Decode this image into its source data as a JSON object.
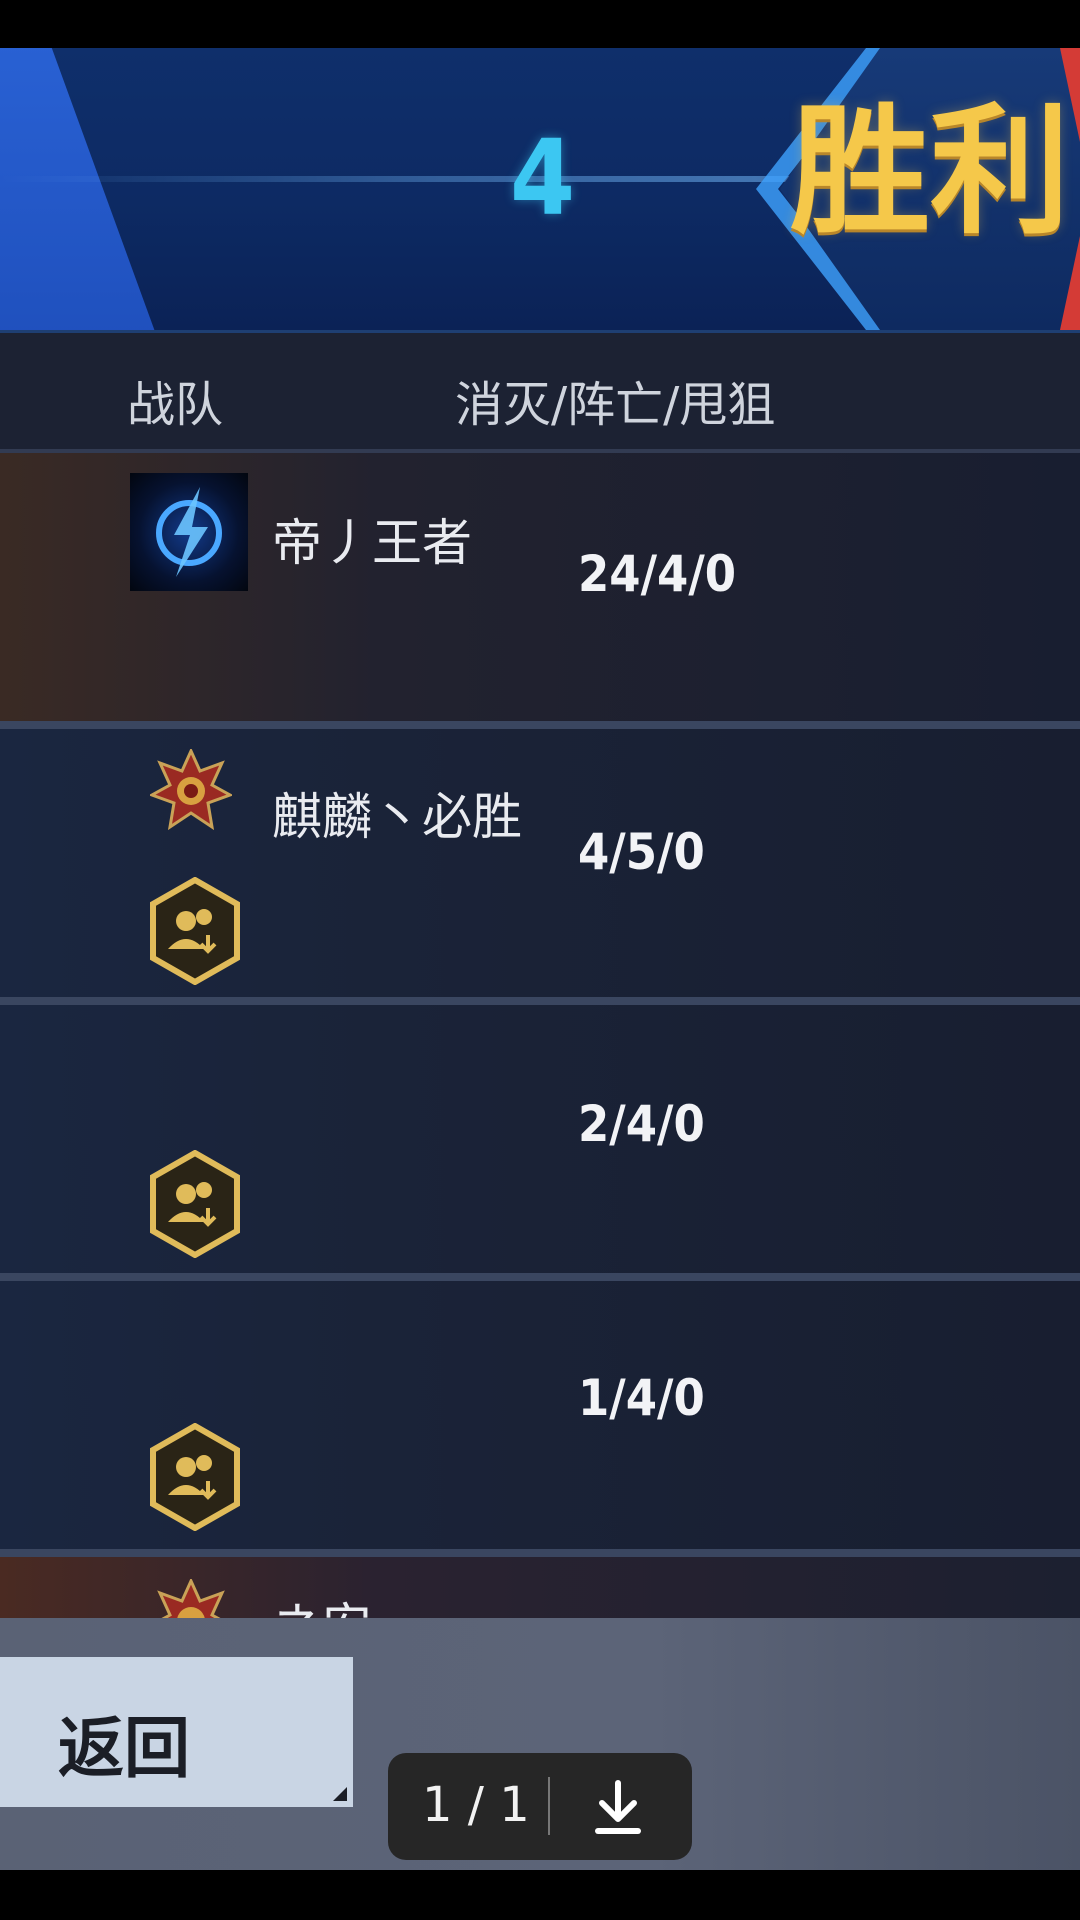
{
  "header": {
    "score": "4",
    "result": "胜利"
  },
  "columns": {
    "team": "战队",
    "stats": "消灭/阵亡/甩狙"
  },
  "rows": [
    {
      "name": "帝丿王者",
      "stats": "24/4/0",
      "avatar": "lightning-logo-avatar",
      "has_team_icon": false
    },
    {
      "name": "麒麟丶必胜",
      "stats": "4/5/0",
      "avatar": "rank-emblem-icon",
      "has_team_icon": true
    },
    {
      "name": "",
      "stats": "2/4/0",
      "avatar": "",
      "has_team_icon": true
    },
    {
      "name": "",
      "stats": "1/4/0",
      "avatar": "",
      "has_team_icon": true
    },
    {
      "name": "ネ安",
      "stats": "",
      "avatar": "rank-emblem-icon",
      "has_team_icon": false
    }
  ],
  "footer": {
    "back_label": "返回"
  },
  "viewer": {
    "page_count": "1 / 1",
    "download_icon": "download-icon"
  },
  "colors": {
    "score": "#3cc7f2",
    "result": "#f5c84a",
    "team_icon": "#e0bb5a"
  }
}
